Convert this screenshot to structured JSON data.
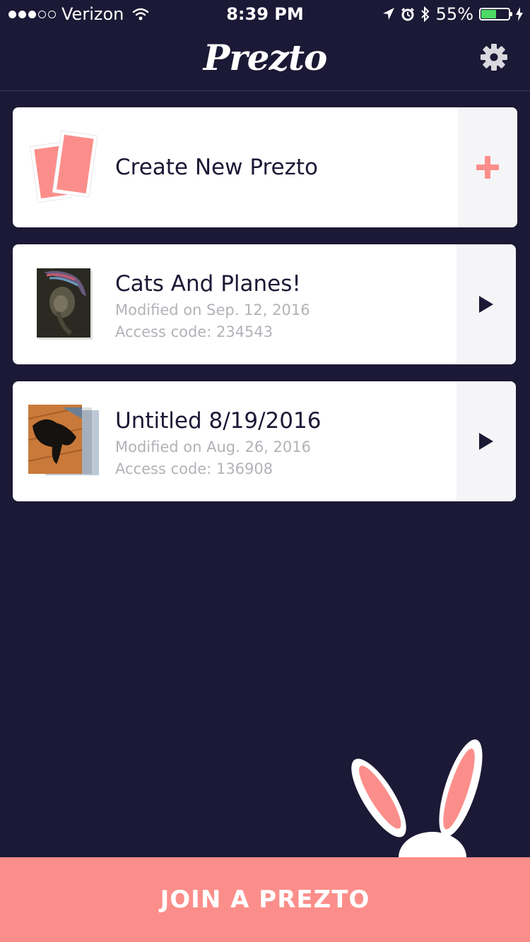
{
  "status_bar": {
    "carrier": "Verizon",
    "time": "8:39 PM",
    "battery_percent": "55%",
    "battery_level": 0.55,
    "signal_bars_filled": 3,
    "signal_bars_total": 5
  },
  "header": {
    "logo_text": "Prezto",
    "settings_icon": "gear-icon"
  },
  "create_card": {
    "label": "Create New Prezto",
    "action_icon": "plus-icon"
  },
  "presentations": [
    {
      "title": "Cats And Planes!",
      "modified": "Modified on Sep. 12, 2016",
      "access_code": "Access code: 234543",
      "action_icon": "play-icon"
    },
    {
      "title": "Untitled 8/19/2016",
      "modified": "Modified on Aug. 26, 2016",
      "access_code": "Access code: 136908",
      "action_icon": "play-icon"
    }
  ],
  "footer": {
    "join_label": "JOIN A PREZTO"
  },
  "colors": {
    "background": "#1b1935",
    "accent": "#fb8e8a",
    "card": "#ffffff",
    "card_side": "#f5f5f7",
    "text_dark": "#1b1935",
    "text_muted": "#b2b2b8",
    "battery": "#4cd964"
  }
}
